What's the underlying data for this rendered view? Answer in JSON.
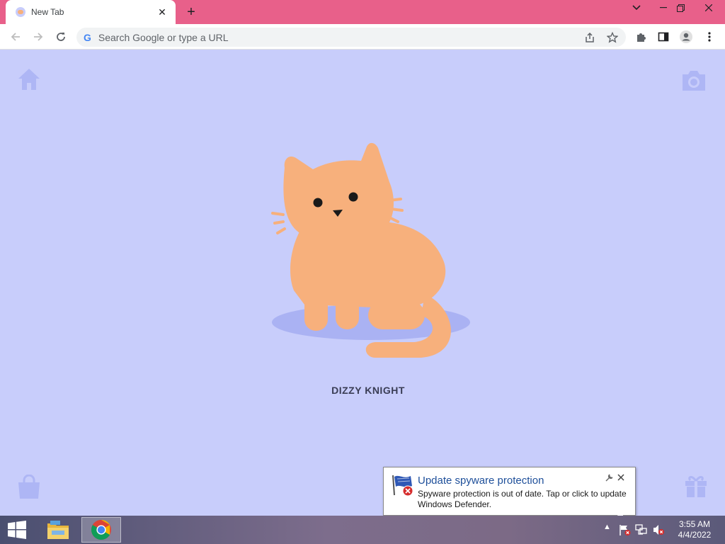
{
  "browser": {
    "tab": {
      "title": "New Tab",
      "close_glyph": "✕"
    },
    "new_tab_glyph": "+",
    "window_controls": {
      "tab_search": "⌄",
      "minimize": "—",
      "restore": "❐",
      "close": "✕"
    },
    "omnibox": {
      "placeholder": "Search Google or type a URL",
      "logo": "G"
    }
  },
  "page": {
    "pet_name": "DIZZY KNIGHT",
    "colors": {
      "background": "#c8cdfb",
      "cat": "#f7b07c",
      "shadow": "#aab2f3",
      "icon": "#aeb6f5"
    },
    "corner_icons": [
      "home-icon",
      "camera-icon",
      "shopping-bag-icon",
      "gift-icon"
    ]
  },
  "notification": {
    "title": "Update spyware protection",
    "body": "Spyware protection is out of date. Tap or click to update Windows Defender."
  },
  "taskbar": {
    "apps": [
      "file-explorer-icon",
      "chrome-icon"
    ],
    "tray": {
      "up_arrow": "▲"
    },
    "clock": {
      "time": "3:55 AM",
      "date": "4/4/2022"
    }
  }
}
